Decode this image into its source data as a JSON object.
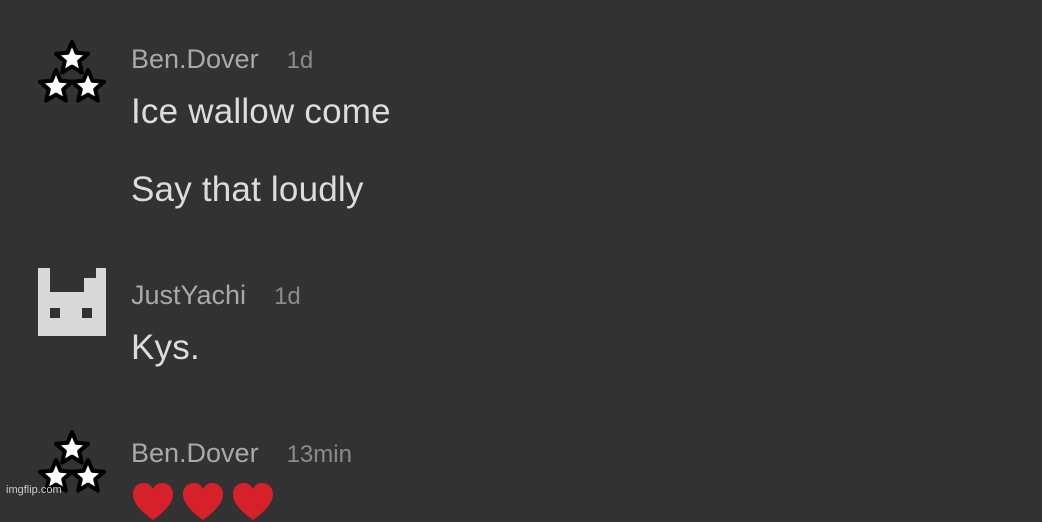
{
  "comments": [
    {
      "username": "Ben.Dover",
      "time": "1d",
      "avatar_icon": "three-stars-icon",
      "messages": [
        "Ice wallow come",
        "Say that loudly"
      ]
    },
    {
      "username": "JustYachi",
      "time": "1d",
      "avatar_icon": "pixel-face-icon",
      "messages": [
        "Kys."
      ]
    },
    {
      "username": "Ben.Dover",
      "time": "13min",
      "avatar_icon": "three-stars-icon",
      "messages": [],
      "reaction_icons": [
        "heart-icon",
        "heart-icon",
        "heart-icon"
      ]
    }
  ],
  "watermark": "imgflip.com",
  "colors": {
    "background": "#323232",
    "username": "#a9a9a9",
    "timestamp": "#8b8b8b",
    "message": "#dcdcdc",
    "heart": "#d6202a"
  }
}
